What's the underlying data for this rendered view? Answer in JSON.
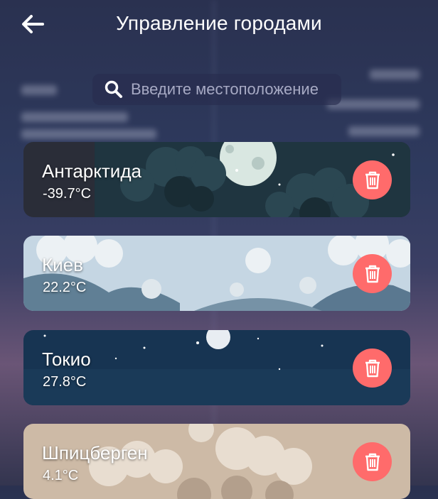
{
  "header": {
    "title": "Управление городами"
  },
  "search": {
    "placeholder": "Введите местоположение"
  },
  "cities": [
    {
      "name": "Антарктида",
      "temp": "-39.7°C",
      "theme": "night-moon",
      "color": "#2a2d3a"
    },
    {
      "name": "Киев",
      "temp": "22.2°C",
      "theme": "rain-day",
      "color": "#b9cedf"
    },
    {
      "name": "Токио",
      "temp": "27.8°C",
      "theme": "clear-night",
      "color": "#173452"
    },
    {
      "name": "Шпицберген",
      "temp": "4.1°C",
      "theme": "cloudy-dusk",
      "color": "#cfb9a4"
    }
  ],
  "colors": {
    "delete": "#ff6b6b",
    "accent_text": "#ffffff"
  }
}
